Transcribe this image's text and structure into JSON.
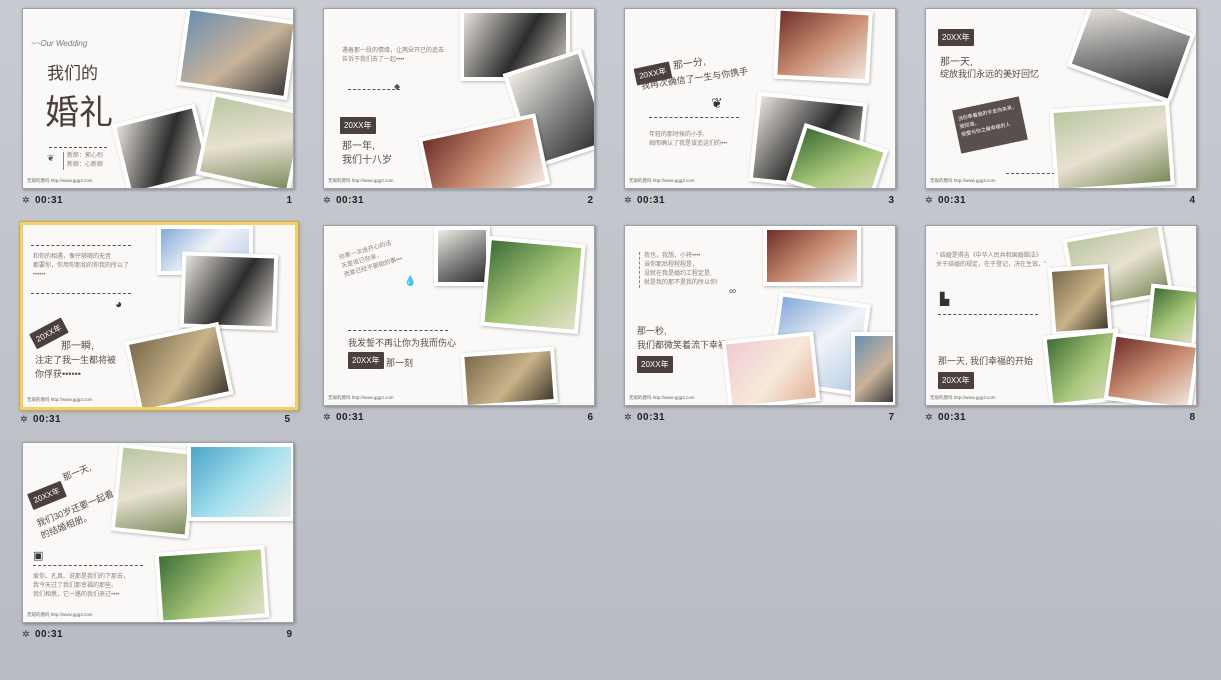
{
  "footer_text": "无垠的唐吗    http://www.ggg3.com",
  "slides": [
    {
      "number": "1",
      "duration": "00:31",
      "selected": false,
      "script_title": "~~Our Wedding",
      "line1": "我们的",
      "line2": "婚礼",
      "names": "新郎：郭心烈\n新娘：心新娘"
    },
    {
      "number": "2",
      "duration": "00:31",
      "selected": false,
      "para": "遇着那一段的情缘，让两朵开已的追击\n告诉于我们去了一起••••",
      "tag": "20XX年",
      "line1": "那一年,",
      "line2": "我们十八岁"
    },
    {
      "number": "3",
      "duration": "00:31",
      "selected": false,
      "tag": "20XX年",
      "line1": "那一分,",
      "line2": "我再次确信了一生与你携手",
      "para": "年轻的那时候的小手,\n姆而确认了我是该追这们的•••"
    },
    {
      "number": "4",
      "duration": "00:31",
      "selected": false,
      "tag": "20XX年",
      "line1": "那一天,",
      "line2": "绽放我们永远的美好回忆",
      "tilt_text": "当你牵着我的手走向未来，\n我知道，\n我要与你之最幸福的人"
    },
    {
      "number": "5",
      "duration": "00:31",
      "selected": true,
      "para": "和你的相遇，像仔够随的无音\n都要你，你用你那如的你我的所以了\n••••••",
      "tag": "20XX年",
      "line1": "那一瞬,",
      "line2": "注定了我一生都将被",
      "line3": "你俘获••••••"
    },
    {
      "number": "6",
      "duration": "00:31",
      "selected": false,
      "para": "你第一次说开心的话\n天是说已你亲，\n而爱已经不那抱的事•••",
      "line1": "我发誓不再让你为我而伤心",
      "tag": "20XX年",
      "line2": "那一刻"
    },
    {
      "number": "7",
      "duration": "00:31",
      "selected": false,
      "para": "我也，我想，小将••••\n当你那后程程程是，\n没就在我是婚约工程定是,\n就是我的那不是我的所以你!",
      "line1": "那一秒,",
      "line2": "我们都微笑着流下幸福的泪",
      "tag": "20XX年"
    },
    {
      "number": "8",
      "duration": "00:31",
      "selected": false,
      "quote": "\" 结婚是得吉《中华人民共和国婚姻法》\n关于结婚的规定，在于登记，决在生效。\"",
      "line1": "那一天, 我们幸福的开始",
      "tag": "20XX年"
    },
    {
      "number": "9",
      "duration": "00:31",
      "selected": false,
      "tag": "20XX年",
      "line1": "那一天,",
      "line2": "我们30岁还要一起看",
      "line3": "的结婚相册。",
      "para": "爱你、孔真、说那是我们的下那去，\n我今天过了我们那幸福的那些。\n我们相携，它一路的我们来过••••"
    }
  ]
}
